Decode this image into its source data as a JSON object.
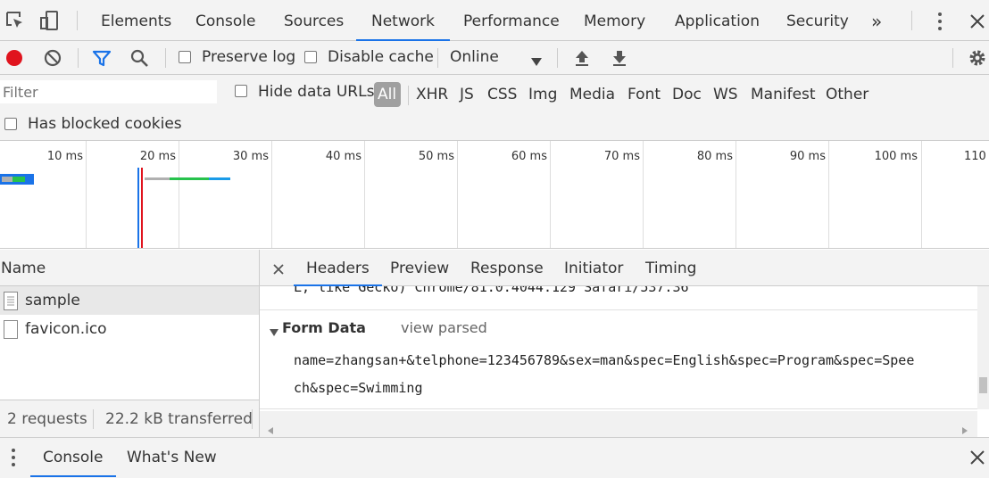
{
  "top_tabs": [
    "Elements",
    "Console",
    "Sources",
    "Network",
    "Performance",
    "Memory",
    "Application",
    "Security"
  ],
  "top_more": "»",
  "toolbar": {
    "preserve_log": "Preserve log",
    "disable_cache": "Disable cache",
    "throttle": "Online"
  },
  "filter": {
    "placeholder": "Filter",
    "hide_data_urls": "Hide data URLs",
    "types": [
      "All",
      "XHR",
      "JS",
      "CSS",
      "Img",
      "Media",
      "Font",
      "Doc",
      "WS",
      "Manifest",
      "Other"
    ],
    "has_blocked_cookies": "Has blocked cookies"
  },
  "overview": {
    "ticks": [
      "10 ms",
      "20 ms",
      "30 ms",
      "40 ms",
      "50 ms",
      "60 ms",
      "70 ms",
      "80 ms",
      "90 ms",
      "100 ms",
      "110"
    ]
  },
  "requests": {
    "header": "Name",
    "items": [
      "sample",
      "favicon.ico"
    ],
    "summary_count": "2 requests",
    "summary_transferred": "22.2 kB transferred"
  },
  "detail": {
    "tabs": [
      "Headers",
      "Preview",
      "Response",
      "Initiator",
      "Timing"
    ],
    "ua_tail": "L, like Gecko) Chrome/81.0.4044.129 Safari/537.36",
    "form_data_title": "Form Data",
    "view_parsed": "view parsed",
    "form_line1": "name=zhangsan+&telphone=123456789&sex=man&spec=English&spec=Program&spec=Spee",
    "form_line2": "ch&spec=Swimming"
  },
  "drawer": {
    "tabs": [
      "Console",
      "What's New"
    ]
  },
  "colors": {
    "accent": "#1a73e8",
    "record": "#e0141e",
    "selected_row": "#e8e8e8"
  }
}
